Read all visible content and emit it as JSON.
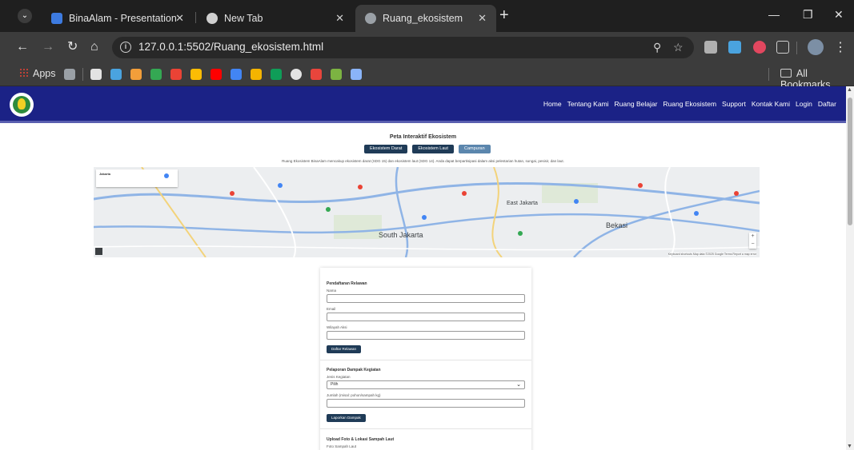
{
  "browser": {
    "tabs": [
      {
        "title": "BinaAlam - Presentation"
      },
      {
        "title": "New Tab"
      },
      {
        "title": "Ruang_ekosistem"
      }
    ],
    "url": "127.0.0.1:5502/Ruang_ekosistem.html",
    "bookmarks": {
      "apps_label": "Apps",
      "all_bookmarks_label": "All Bookmarks"
    }
  },
  "site": {
    "nav_links": [
      "Home",
      "Tentang Kami",
      "Ruang Belajar",
      "Ruang Ekosistem",
      "Support",
      "Kontak Kami",
      "Login",
      "Daftar"
    ],
    "section_title": "Peta Interaktif Ekosistem",
    "filter_buttons": [
      "Ekosistem Darat",
      "Ekosistem Laut",
      "Campuran"
    ],
    "description": "Ruang Ekosistem BinaAlam mencakup ekosistem darat (SDG 15) dan ekosistem laut (SDG 14). Anda dapat berpartisipasi dalam aksi pelestarian hutan, sungai, pesisir, dan laut."
  },
  "map": {
    "labels": [
      "South Jakarta",
      "East Jakarta",
      "Bekasi",
      "Jakarta"
    ],
    "attribution": "Keyboard shortcuts  Map data ©2025 Google  Terms  Report a map error"
  },
  "form": {
    "volunteer": {
      "title": "Pendaftaran Relawan",
      "name_label": "Nama",
      "email_label": "Email",
      "region_label": "Wilayah Aksi",
      "submit_label": "Daftar Relawan"
    },
    "impact": {
      "title": "Pelaporan Dampak Kegiatan",
      "type_label": "Jenis Kegiatan",
      "type_value": "Pilih",
      "amount_label": "Jumlah (misal: pohon/sampah kg)",
      "submit_label": "Laporkan Dampak"
    },
    "upload": {
      "title": "Upload Foto & Lokasi Sampah Laut",
      "photo_label": "Foto Sampah Laut"
    }
  },
  "colors": {
    "nav_bg": "#1b2286",
    "button_bg": "#1f3b57",
    "button_active": "#5b86ad"
  }
}
